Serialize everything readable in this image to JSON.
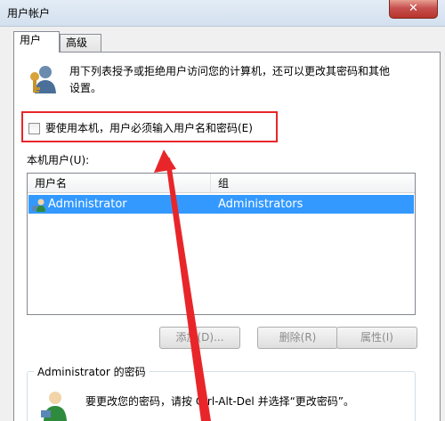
{
  "window": {
    "title": "用户帐户",
    "close_glyph": "✕"
  },
  "tabs": [
    {
      "label": "用户"
    },
    {
      "label": "高级"
    }
  ],
  "users_tab": {
    "description_line1": "用下列表授予或拒绝用户访问您的计算机，还可以更改其密码和其他",
    "description_line2": "设置。",
    "require_password_label": "要使用本机，用户必须输入用户名和密码(E)",
    "local_users_label": "本机用户(U):",
    "table": {
      "columns": [
        "用户名",
        "组"
      ],
      "rows": [
        {
          "username": "Administrator",
          "group": "Administrators"
        }
      ]
    },
    "buttons": {
      "add": "添加(D)...",
      "remove": "删除(R)",
      "properties": "属性(I)"
    },
    "password_group": {
      "title": "Administrator 的密码",
      "description": "要更改您的密码，请按 Ctrl-Alt-Del 并选择“更改密码”。"
    }
  },
  "colors": {
    "highlight_border": "#e8262a",
    "selection": "#3399ff",
    "arrow": "#e8262a"
  }
}
